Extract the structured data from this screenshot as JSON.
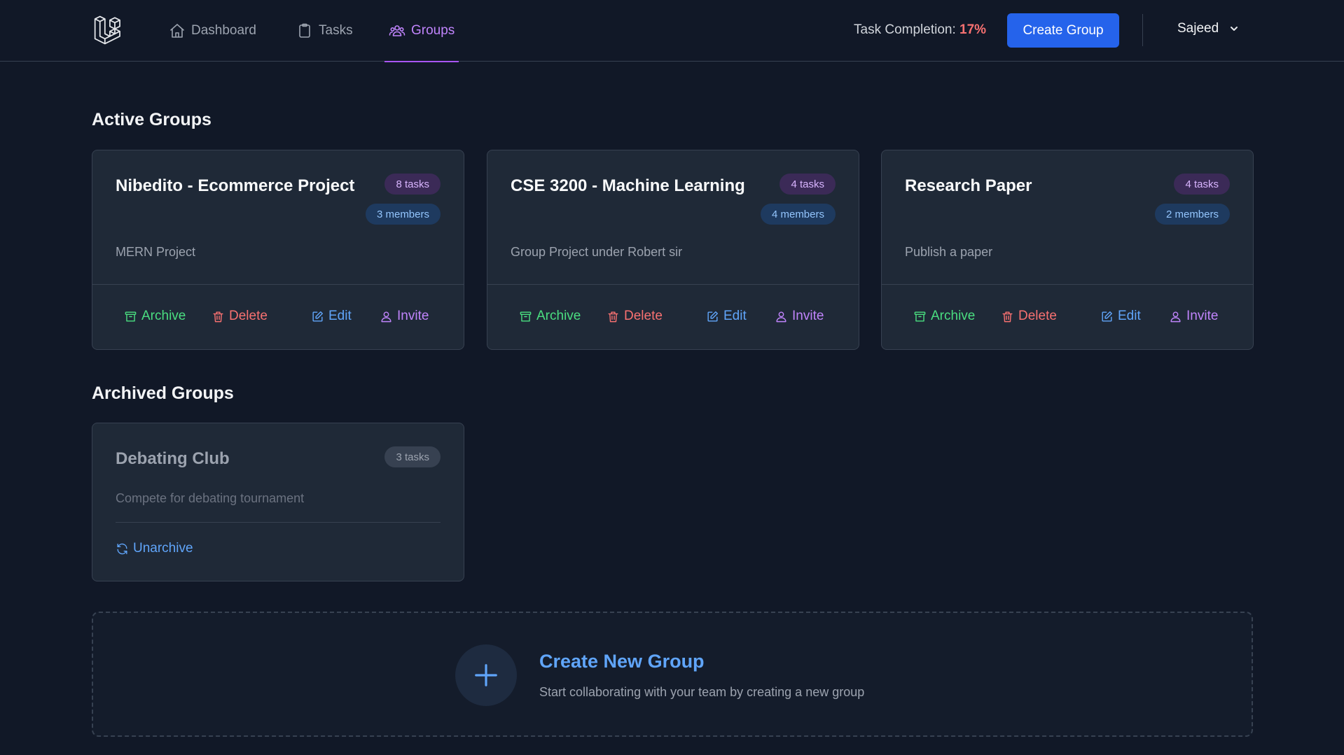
{
  "nav": {
    "links": [
      {
        "label": "Dashboard",
        "icon": "home-icon"
      },
      {
        "label": "Tasks",
        "icon": "clipboard-icon"
      },
      {
        "label": "Groups",
        "icon": "users-icon",
        "active": true
      }
    ],
    "completion_label": "Task Completion:",
    "completion_value": "17%",
    "create_button": "Create Group",
    "user_name": "Sajeed"
  },
  "active_section": {
    "title": "Active Groups",
    "groups": [
      {
        "title": "Nibedito - Ecommerce Project",
        "tasks": "8 tasks",
        "members": "3 members",
        "description": "MERN Project"
      },
      {
        "title": "CSE 3200 - Machine Learning",
        "tasks": "4 tasks",
        "members": "4 members",
        "description": "Group Project under Robert sir"
      },
      {
        "title": "Research Paper",
        "tasks": "4 tasks",
        "members": "2 members",
        "description": "Publish a paper"
      }
    ],
    "actions": {
      "archive": "Archive",
      "delete": "Delete",
      "edit": "Edit",
      "invite": "Invite"
    }
  },
  "archived_section": {
    "title": "Archived Groups",
    "groups": [
      {
        "title": "Debating Club",
        "tasks": "3 tasks",
        "description": "Compete for debating tournament",
        "action": "Unarchive"
      }
    ]
  },
  "create_new": {
    "title": "Create New Group",
    "subtitle": "Start collaborating with your team by creating a new group"
  },
  "colors": {
    "background": "#111827",
    "card": "#1f2937",
    "accent_purple": "#c084fc",
    "primary_blue": "#2563eb",
    "archive_green": "#4ade80",
    "delete_red": "#f87171",
    "edit_blue": "#60a5fa"
  }
}
